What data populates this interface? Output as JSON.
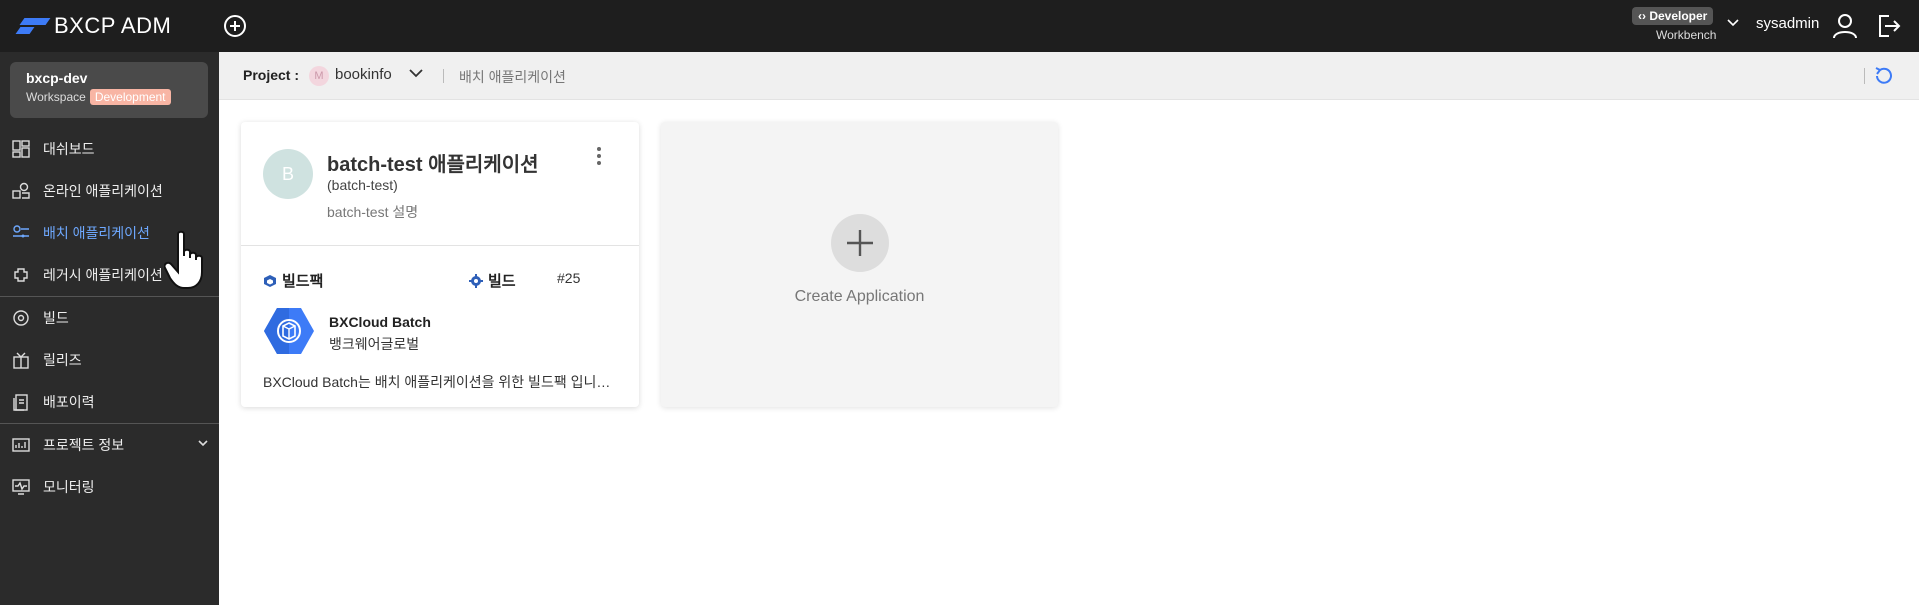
{
  "topbar": {
    "logo_text": "BXCP ADMIN",
    "developer_badge": "‹› Developer",
    "developer_sub": "Workbench",
    "username": "sysadmin"
  },
  "sidebar": {
    "workspace_name": "bxcp-dev",
    "workspace_label": "Workspace",
    "workspace_badge": "Development",
    "items": [
      {
        "label": "대쉬보드",
        "icon": "dashboard-icon"
      },
      {
        "label": "온라인 애플리케이션",
        "icon": "online-app-icon"
      },
      {
        "label": "배치 애플리케이션",
        "icon": "batch-app-icon",
        "active": true
      },
      {
        "label": "레거시 애플리케이션",
        "icon": "legacy-app-icon"
      },
      {
        "label": "빌드",
        "icon": "build-icon"
      },
      {
        "label": "릴리즈",
        "icon": "release-icon"
      },
      {
        "label": "배포이력",
        "icon": "deploy-history-icon"
      },
      {
        "label": "프로젝트 정보",
        "icon": "project-info-icon"
      },
      {
        "label": "모니터링",
        "icon": "monitoring-icon"
      }
    ]
  },
  "subheader": {
    "project_label": "Project :",
    "project_avatar": "M",
    "project_name": "bookinfo",
    "breadcrumb": "배치 애플리케이션"
  },
  "app_card": {
    "avatar": "B",
    "title": "batch-test 애플리케이션",
    "id": "(batch-test)",
    "description": "batch-test 설명",
    "buildpack_label": "빌드팩",
    "build_label": "빌드",
    "build_number": "#25",
    "buildpack_name": "BXCloud Batch",
    "buildpack_vendor": "뱅크웨어글로벌",
    "buildpack_desc": "BXCloud Batch는 배치 애플리케이션을 위한 빌드팩 입니다."
  },
  "create_card": {
    "label": "Create Application"
  },
  "colors": {
    "topbar_bg": "#1e1e1e",
    "sidebar_bg": "#2b2b2b",
    "active_nav": "#6ea8fe",
    "accent_blue": "#3d7bf7",
    "badge_bg": "#f8b5a4"
  }
}
